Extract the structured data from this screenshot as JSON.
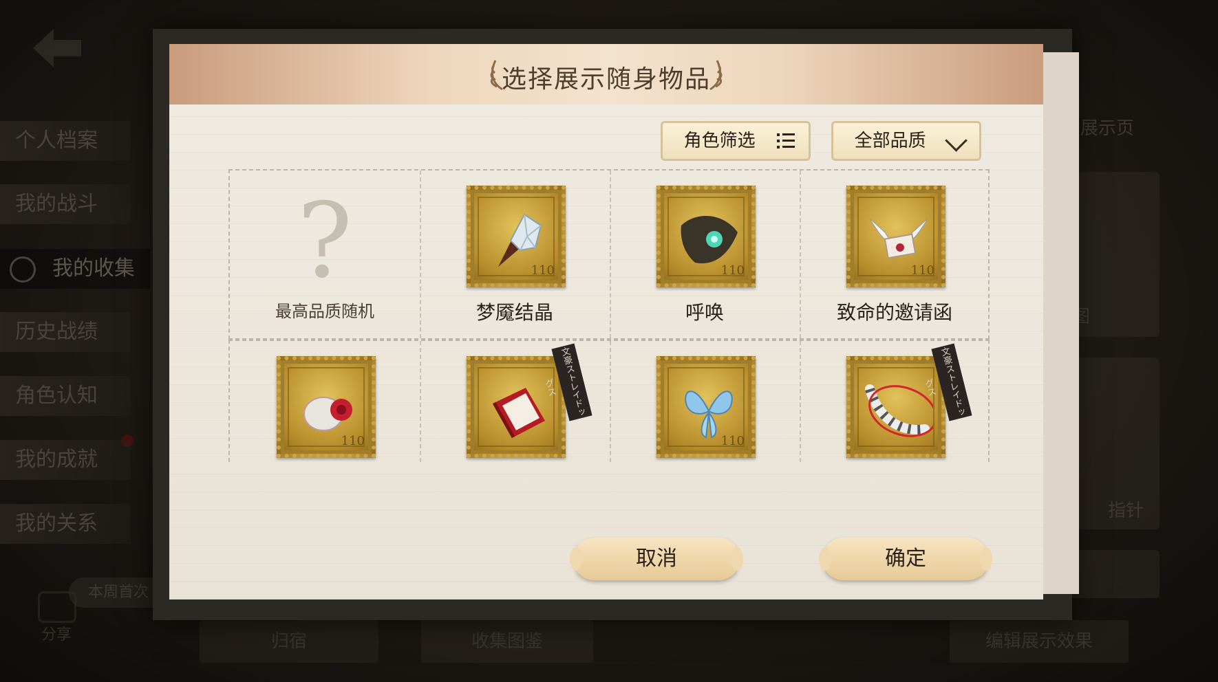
{
  "sidebar": {
    "items": [
      "个人档案",
      "我的战斗",
      "我的收集",
      "历史战绩",
      "角色认知",
      "我的成就",
      "我的关系"
    ],
    "active_index": 2,
    "weekly_badge": "本周首次",
    "share_label": "分享"
  },
  "background": {
    "right_top_label": "展示页",
    "right_mid_label": "图",
    "right_low_label": "指针",
    "bottom_left_label": "归宿",
    "bottom_mid_label": "收集图鉴",
    "bottom_right_label": "编辑展示效果"
  },
  "dialog": {
    "title": "选择展示随身物品",
    "filters": {
      "role_filter_label": "角色筛选",
      "quality_filter_label": "全部品质"
    },
    "row1": [
      {
        "name": "最高品质随机",
        "icon": "question-mark-icon",
        "stamp_number": ""
      },
      {
        "name": "梦魇结晶",
        "icon": "crystal-icon",
        "stamp_number": "110"
      },
      {
        "name": "呼唤",
        "icon": "summon-orb-icon",
        "stamp_number": "110"
      },
      {
        "name": "致命的邀请函",
        "icon": "winged-letter-icon",
        "stamp_number": "110"
      }
    ],
    "row2": [
      {
        "name": "",
        "icon": "rose-pendant-icon",
        "stamp_number": "110",
        "tag": ""
      },
      {
        "name": "",
        "icon": "red-book-icon",
        "stamp_number": "",
        "tag": "文豪ストレイドッグス"
      },
      {
        "name": "",
        "icon": "blue-butterfly-icon",
        "stamp_number": "110",
        "tag": ""
      },
      {
        "name": "",
        "icon": "striped-tail-icon",
        "stamp_number": "",
        "tag": "文豪ストレイドッグス"
      }
    ],
    "cancel_label": "取消",
    "confirm_label": "确定"
  },
  "colors": {
    "accent_gold": "#c9a44a",
    "header_tan": "#e8c9aa",
    "button_cream": "#f1dcb3"
  }
}
